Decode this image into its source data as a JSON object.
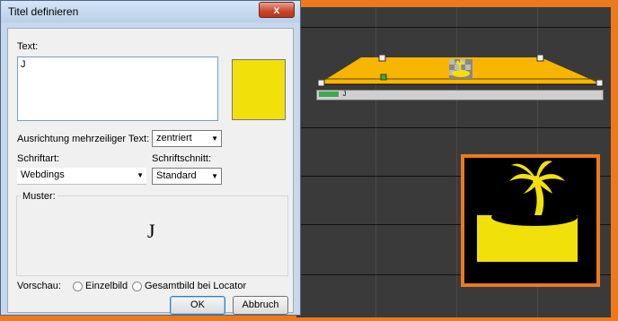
{
  "dialog": {
    "title": "Titel definieren",
    "close_label": "x",
    "text_label": "Text:",
    "text_value": "J",
    "color_swatch": "#f2e00a",
    "alignment_label": "Ausrichtung mehrzeiliger Text:",
    "alignment_value": "zentriert",
    "font_label": "Schriftart:",
    "font_value": "Webdings",
    "style_label": "Schriftschnitt:",
    "style_value": "Standard",
    "sample_label": "Muster:",
    "sample_text": "J",
    "preview_label": "Vorschau:",
    "radio_single": "Einzelbild",
    "radio_locator": "Gesamtbild bei Locator",
    "ok_label": "OK",
    "cancel_label": "Abbruch"
  },
  "editor": {
    "clip_marker": "J",
    "clip_color": "#f7b500",
    "island_color": "#f2e00a",
    "scroll_thumb_color": "#3fa94f"
  }
}
